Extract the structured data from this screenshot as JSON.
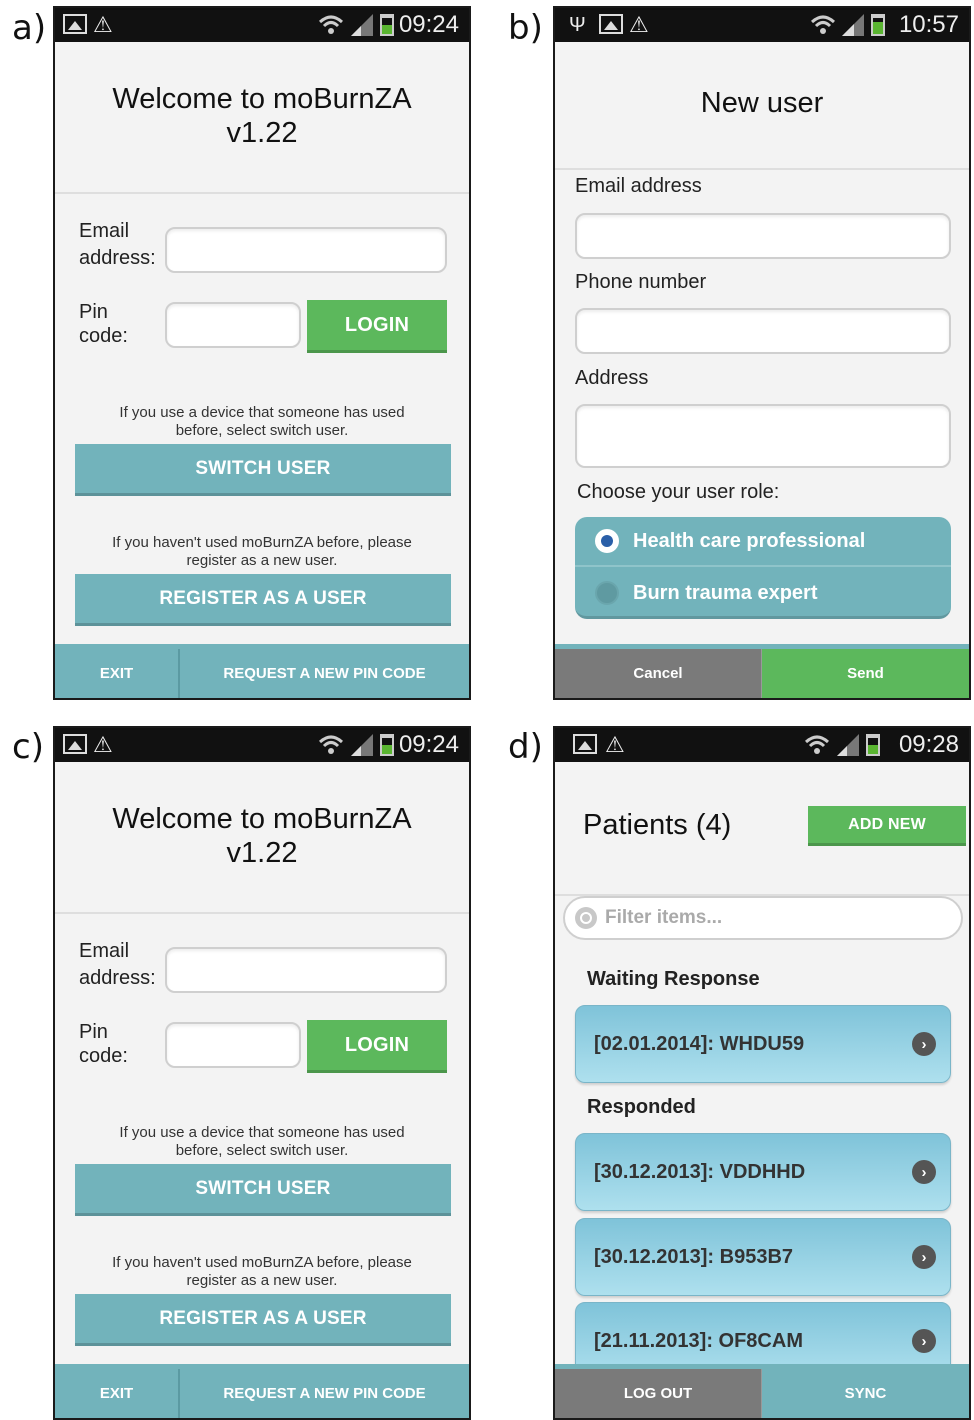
{
  "panel_labels": [
    "a)",
    "b)",
    "c)",
    "d)"
  ],
  "login": {
    "time": "09:24",
    "title_line1": "Welcome to moBurnZA",
    "title_line2": "v1.22",
    "email_label_1": "Email",
    "email_label_2": "address:",
    "email_value": "",
    "pin_label_1": "Pin",
    "pin_label_2": "code:",
    "pin_value": "",
    "login_button": "LOGIN",
    "switch_note_1": "If you use a device that someone has used",
    "switch_note_2": "before, select switch user.",
    "switch_button": "SWITCH USER",
    "register_note_1": "If you haven't used moBurnZA before, please",
    "register_note_2": "register as a new user.",
    "register_button": "REGISTER AS A USER",
    "footer_exit": "EXIT",
    "footer_request_pin": "REQUEST A NEW PIN CODE",
    "battery_level": 0.55,
    "icons": [
      "image-icon",
      "warning-icon",
      "wifi-icon",
      "signal-icon",
      "battery-icon"
    ]
  },
  "new_user": {
    "time": "10:57",
    "title": "New user",
    "email_label": "Email address",
    "email_value": "",
    "phone_label": "Phone number",
    "phone_value": "",
    "address_label": "Address",
    "address_value": "",
    "role_label": "Choose your user role:",
    "roles": [
      {
        "label": "Health care professional",
        "selected": true
      },
      {
        "label": "Burn trauma expert",
        "selected": false
      }
    ],
    "cancel_button": "Cancel",
    "send_button": "Send",
    "battery_level": 0.75,
    "icons": [
      "usb-icon",
      "image-icon",
      "warning-icon",
      "wifi-icon",
      "signal-icon",
      "battery-charging-icon"
    ]
  },
  "patients": {
    "time": "09:28",
    "title": "Patients (4)",
    "add_new_button": "ADD NEW",
    "filter_placeholder": "Filter items...",
    "group_waiting": "Waiting Response",
    "group_responded": "Responded",
    "waiting": [
      "[02.01.2014]: WHDU59"
    ],
    "responded": [
      "[30.12.2013]: VDDHHD",
      "[30.12.2013]: B953B7",
      "[21.11.2013]: OF8CAM"
    ],
    "logout_button": "LOG OUT",
    "sync_button": "SYNC",
    "battery_level": 0.55
  },
  "colors": {
    "teal": "#72b3bb",
    "green": "#5cb85c",
    "gray_button": "#7a7a7a",
    "status_bar": "#111111",
    "background": "#f3f3f3",
    "radio_selected": "#2a5fa8"
  }
}
